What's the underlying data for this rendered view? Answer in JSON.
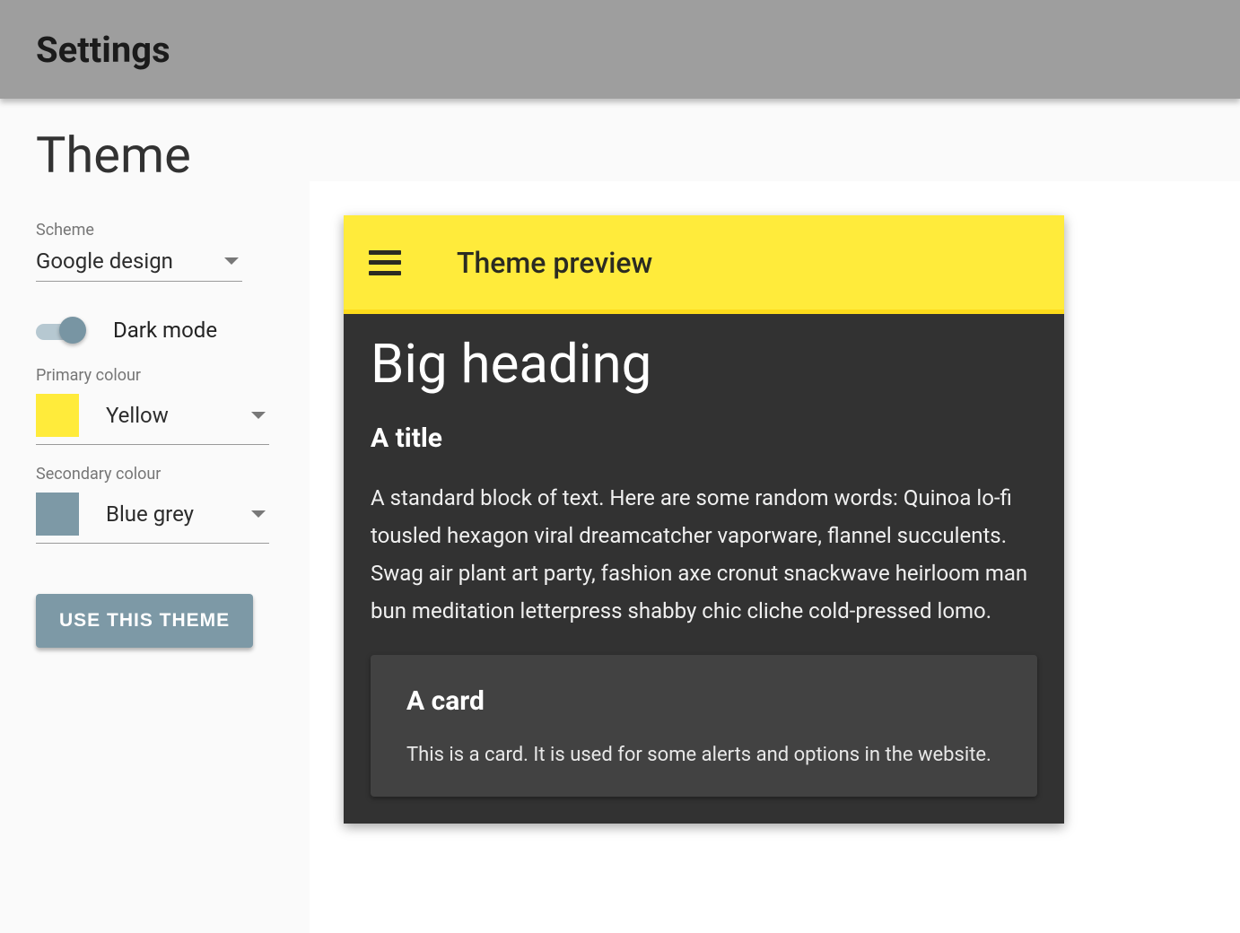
{
  "appbar": {
    "title": "Settings"
  },
  "page": {
    "heading": "Theme"
  },
  "scheme": {
    "label": "Scheme",
    "value": "Google design"
  },
  "dark_mode": {
    "label": "Dark mode",
    "enabled": true
  },
  "primary": {
    "label": "Primary colour",
    "value": "Yellow",
    "hex": "#ffeb3b"
  },
  "secondary": {
    "label": "Secondary colour",
    "value": "Blue grey",
    "hex": "#7d99a6"
  },
  "apply_button": "USE THIS THEME",
  "preview": {
    "toolbar_title": "Theme preview",
    "big_heading": "Big heading",
    "title": "A title",
    "paragraph": "A standard block of text. Here are some random words: Quinoa lo-fi tousled hexagon viral dreamcatcher vaporware, flannel succulents. Swag air plant art party, fashion axe cronut snackwave heirloom man bun meditation letterpress shabby chic cliche cold-pressed lomo.",
    "card": {
      "title": "A card",
      "text": "This is a card. It is used for some alerts and options in the website."
    }
  },
  "colors": {
    "appbar_bg": "#9e9e9e",
    "preview_bg": "#323232",
    "preview_card_bg": "#424242"
  }
}
